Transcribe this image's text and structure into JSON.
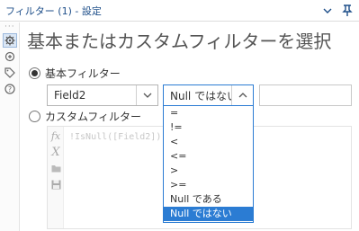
{
  "window": {
    "title": "フィルター (1) - 設定",
    "collapse_icon": "chevron-down-icon",
    "pin_icon": "pin-icon"
  },
  "rail": {
    "dots": "···",
    "icons": [
      "gear-icon",
      "connection-icon",
      "tag-icon",
      "help-icon"
    ]
  },
  "heading": "基本またはカスタムフィルターを選択",
  "basic_filter": {
    "label": "基本フィルター",
    "selected": true,
    "field_select": {
      "value": "Field2"
    },
    "operator_select": {
      "value": "Null ではない"
    },
    "value_input": {
      "value": ""
    }
  },
  "custom_filter": {
    "label": "カスタムフィルター",
    "selected": false,
    "expression": "!IsNull([Field2])",
    "tools": [
      "fx-icon",
      "variable-icon",
      "folder-icon",
      "save-icon"
    ]
  },
  "operator_options": [
    "=",
    "!=",
    "<",
    "<=",
    ">",
    ">=",
    "Null である",
    "Null ではない"
  ],
  "operator_selected_index": 7,
  "colors": {
    "accent": "#2b7cd3",
    "title_text": "#1d4e89"
  }
}
